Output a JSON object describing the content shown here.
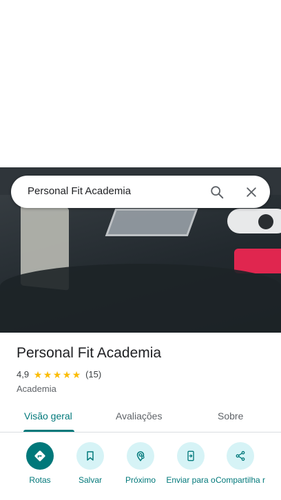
{
  "search": {
    "query": "Personal Fit Academia"
  },
  "place": {
    "title": "Personal Fit Academia",
    "rating": "4,9",
    "stars": 5,
    "reviews_count": "(15)",
    "category": "Academia"
  },
  "tabs": [
    {
      "label": "Visão geral",
      "active": true
    },
    {
      "label": "Avaliações",
      "active": false
    },
    {
      "label": "Sobre",
      "active": false
    }
  ],
  "actions": [
    {
      "label": "Rotas",
      "icon": "directions-icon"
    },
    {
      "label": "Salvar",
      "icon": "bookmark-icon"
    },
    {
      "label": "Próximo",
      "icon": "nearby-icon"
    },
    {
      "label": "Enviar para o",
      "icon": "send-to-phone-icon"
    },
    {
      "label": "Compartilha r",
      "icon": "share-icon"
    }
  ],
  "colors": {
    "accent": "#00787a",
    "accent_light": "#d6f3f6",
    "star": "#fbbc04"
  }
}
